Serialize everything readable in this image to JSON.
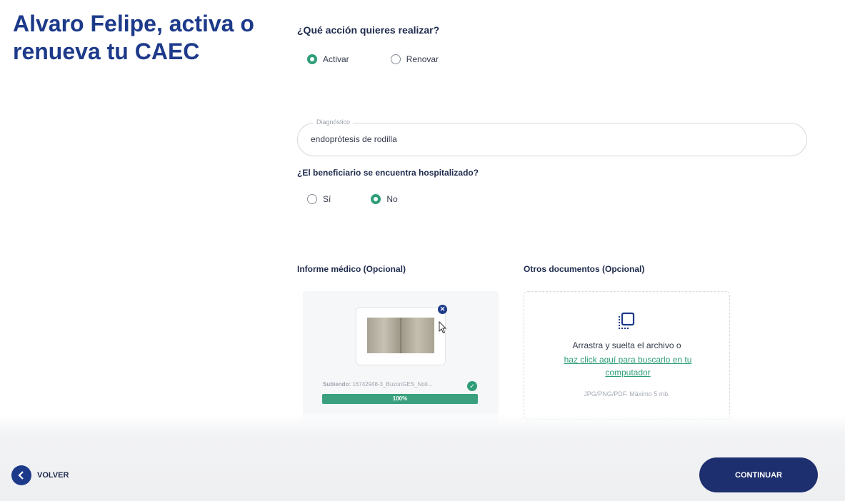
{
  "header": {
    "title": "Alvaro Felipe, activa o renueva tu CAEC"
  },
  "action": {
    "question": "¿Qué acción quieres realizar?",
    "options": [
      {
        "label": "Activar",
        "selected": true
      },
      {
        "label": "Renovar",
        "selected": false
      }
    ]
  },
  "diagnosis": {
    "label": "Diagnóstico",
    "value": "endoprótesis de rodilla"
  },
  "hospitalized": {
    "question": "¿El beneficiario se encuentra hospitalizado?",
    "options": [
      {
        "label": "Sí",
        "selected": false
      },
      {
        "label": "No",
        "selected": true
      }
    ]
  },
  "medical_report": {
    "title": "Informe médico (Opcional)",
    "uploading_prefix": "Subiendo:",
    "file_name": "16742948-3_BuzonGES_Noti...",
    "progress_value": 100,
    "progress_text": "100%"
  },
  "other_documents": {
    "title": "Otros documentos (Opcional)",
    "drop_text": "Arrastra y suelta el archivo o",
    "link_text": "haz click aquí para buscarlo en tu computador",
    "note": "JPG/PNG/PDF. Máximo 5 mb."
  },
  "footer": {
    "back_label": "VOLVER",
    "continue_label": "CONTINUAR"
  },
  "colors": {
    "primary": "#1d3a8a",
    "accent": "#2f9e78",
    "button": "#1d2f6e"
  },
  "icons": {
    "remove": "close-icon",
    "upload": "upload-icon",
    "check": "check-icon",
    "back": "chevron-left-icon",
    "cursor": "cursor-icon"
  }
}
